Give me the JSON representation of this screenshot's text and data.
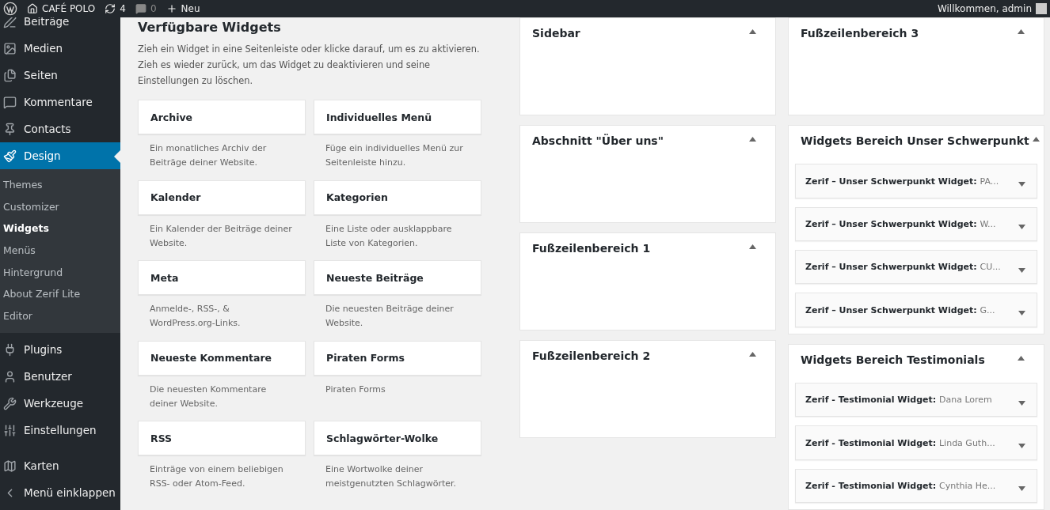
{
  "admin_bar": {
    "site": "CAFÉ POLO",
    "updates": "4",
    "comments": "0",
    "new": "Neu",
    "greeting": "Willkommen, admin"
  },
  "sidebar": {
    "items": [
      {
        "label": "Beiträge",
        "selected": false
      },
      {
        "label": "Medien",
        "selected": false
      },
      {
        "label": "Seiten",
        "selected": false
      },
      {
        "label": "Kommentare",
        "selected": false
      },
      {
        "label": "Contacts",
        "selected": false
      },
      {
        "label": "Design",
        "selected": true,
        "children": [
          {
            "label": "Themes",
            "selected": false
          },
          {
            "label": "Customizer",
            "selected": false
          },
          {
            "label": "Widgets",
            "selected": true
          },
          {
            "label": "Menüs",
            "selected": false
          },
          {
            "label": "Hintergrund",
            "selected": false
          },
          {
            "label": "About Zerif Lite",
            "selected": false
          },
          {
            "label": "Editor",
            "selected": false
          }
        ]
      },
      {
        "label": "Plugins",
        "selected": false
      },
      {
        "label": "Benutzer",
        "selected": false
      },
      {
        "label": "Werkzeuge",
        "selected": false
      },
      {
        "label": "Einstellungen",
        "selected": false
      },
      {
        "label": "Karten",
        "selected": false
      },
      {
        "label": "Menü einklappen",
        "selected": false
      }
    ]
  },
  "available_widgets": {
    "title": "Verfügbare Widgets",
    "description": "Zieh ein Widget in eine Seitenleiste oder klicke darauf, um es zu aktivieren. Zieh es wieder zurück, um das Widget zu deaktivieren und seine Einstellungen zu löschen.",
    "widgets": [
      {
        "title": "Archive",
        "description": "Ein monatliches Archiv der Beiträge deiner Website."
      },
      {
        "title": "Individuelles Menü",
        "description": "Füge ein individuelles Menü zur Seitenleiste hinzu."
      },
      {
        "title": "Kalender",
        "description": "Ein Kalender der Beiträge deiner Website."
      },
      {
        "title": "Kategorien",
        "description": "Eine Liste oder ausklappbare Liste von Kategorien."
      },
      {
        "title": "Meta",
        "description": "Anmelde-, RSS-, & WordPress.org-Links."
      },
      {
        "title": "Neueste Beiträge",
        "description": "Die neuesten Beiträge deiner Website."
      },
      {
        "title": "Neueste Kommentare",
        "description": "Die neuesten Kommentare deiner Website."
      },
      {
        "title": "Piraten Forms",
        "description": "Piraten Forms"
      },
      {
        "title": "RSS",
        "description": "Einträge von einem beliebigen RSS- oder Atom-Feed."
      },
      {
        "title": "Schlagwörter-Wolke",
        "description": "Eine Wortwolke deiner meistgenutzten Schlagwörter."
      }
    ]
  },
  "areas_column_1": [
    {
      "title": "Sidebar",
      "expanded": true
    },
    {
      "title": "Abschnitt \"Über uns\"",
      "expanded": true
    },
    {
      "title": "Fußzeilenbereich 1",
      "expanded": true
    },
    {
      "title": "Fußzeilenbereich 2",
      "expanded": true
    }
  ],
  "areas_column_2": [
    {
      "title": "Fußzeilenbereich 3",
      "expanded": true
    },
    {
      "title": "Widgets Bereich Unser Schwerpunkt",
      "expanded": true,
      "widgets": [
        {
          "title": "Zerif – Unser Schwerpunkt Widget:",
          "detail": "PA...",
          "expanded": false
        },
        {
          "title": "Zerif – Unser Schwerpunkt Widget:",
          "detail": "W...",
          "expanded": false
        },
        {
          "title": "Zerif – Unser Schwerpunkt Widget:",
          "detail": "CU...",
          "expanded": false
        },
        {
          "title": "Zerif – Unser Schwerpunkt Widget:",
          "detail": "G...",
          "expanded": false
        }
      ]
    },
    {
      "title": "Widgets Bereich Testimonials",
      "expanded": true,
      "widgets": [
        {
          "title": "Zerif - Testimonial Widget:",
          "detail": "Dana Lorem",
          "expanded": false
        },
        {
          "title": "Zerif - Testimonial Widget:",
          "detail": "Linda Guth...",
          "expanded": false
        },
        {
          "title": "Zerif - Testimonial Widget:",
          "detail": "Cynthia He...",
          "expanded": false
        }
      ]
    }
  ]
}
